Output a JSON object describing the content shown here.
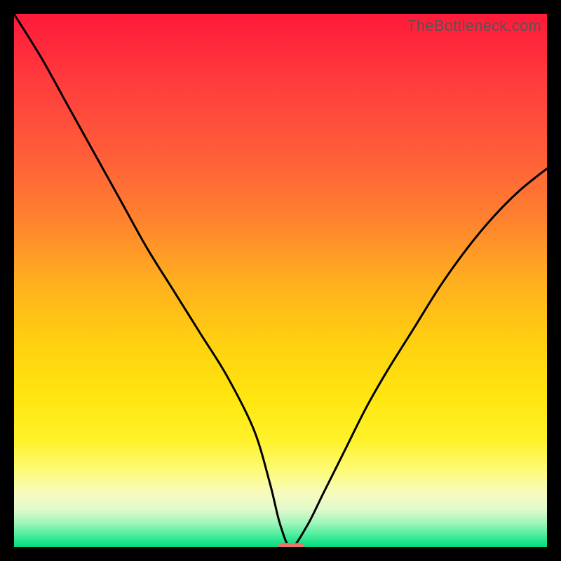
{
  "watermark": "TheBottleneck.com",
  "chart_data": {
    "type": "line",
    "title": "",
    "xlabel": "",
    "ylabel": "",
    "xlim": [
      0,
      100
    ],
    "ylim": [
      0,
      100
    ],
    "grid": false,
    "legend": false,
    "series": [
      {
        "name": "bottleneck-curve",
        "x": [
          0,
          5,
          10,
          15,
          20,
          25,
          30,
          35,
          40,
          45,
          48,
          50,
          52,
          55,
          58,
          62,
          66,
          70,
          75,
          80,
          85,
          90,
          95,
          100
        ],
        "y": [
          100,
          92,
          83,
          74,
          65,
          56,
          48,
          40,
          32,
          22,
          12,
          4,
          0,
          4,
          10,
          18,
          26,
          33,
          41,
          49,
          56,
          62,
          67,
          71
        ]
      }
    ],
    "marker": {
      "name": "optimal-point",
      "x": 52,
      "y": 0,
      "width": 5,
      "height": 1.5,
      "color": "#e8766a"
    },
    "gradient_stops": [
      {
        "offset": 0.0,
        "color": "#ff1a3a"
      },
      {
        "offset": 0.12,
        "color": "#ff3a3d"
      },
      {
        "offset": 0.25,
        "color": "#ff5a3a"
      },
      {
        "offset": 0.38,
        "color": "#ff8030"
      },
      {
        "offset": 0.5,
        "color": "#ffae1f"
      },
      {
        "offset": 0.62,
        "color": "#ffd110"
      },
      {
        "offset": 0.72,
        "color": "#ffe610"
      },
      {
        "offset": 0.8,
        "color": "#fff22a"
      },
      {
        "offset": 0.86,
        "color": "#fdfb7c"
      },
      {
        "offset": 0.9,
        "color": "#f6fbc0"
      },
      {
        "offset": 0.93,
        "color": "#e0faca"
      },
      {
        "offset": 0.955,
        "color": "#a0f5bb"
      },
      {
        "offset": 0.975,
        "color": "#55eea0"
      },
      {
        "offset": 0.99,
        "color": "#1de58c"
      },
      {
        "offset": 1.0,
        "color": "#06db7d"
      }
    ]
  }
}
